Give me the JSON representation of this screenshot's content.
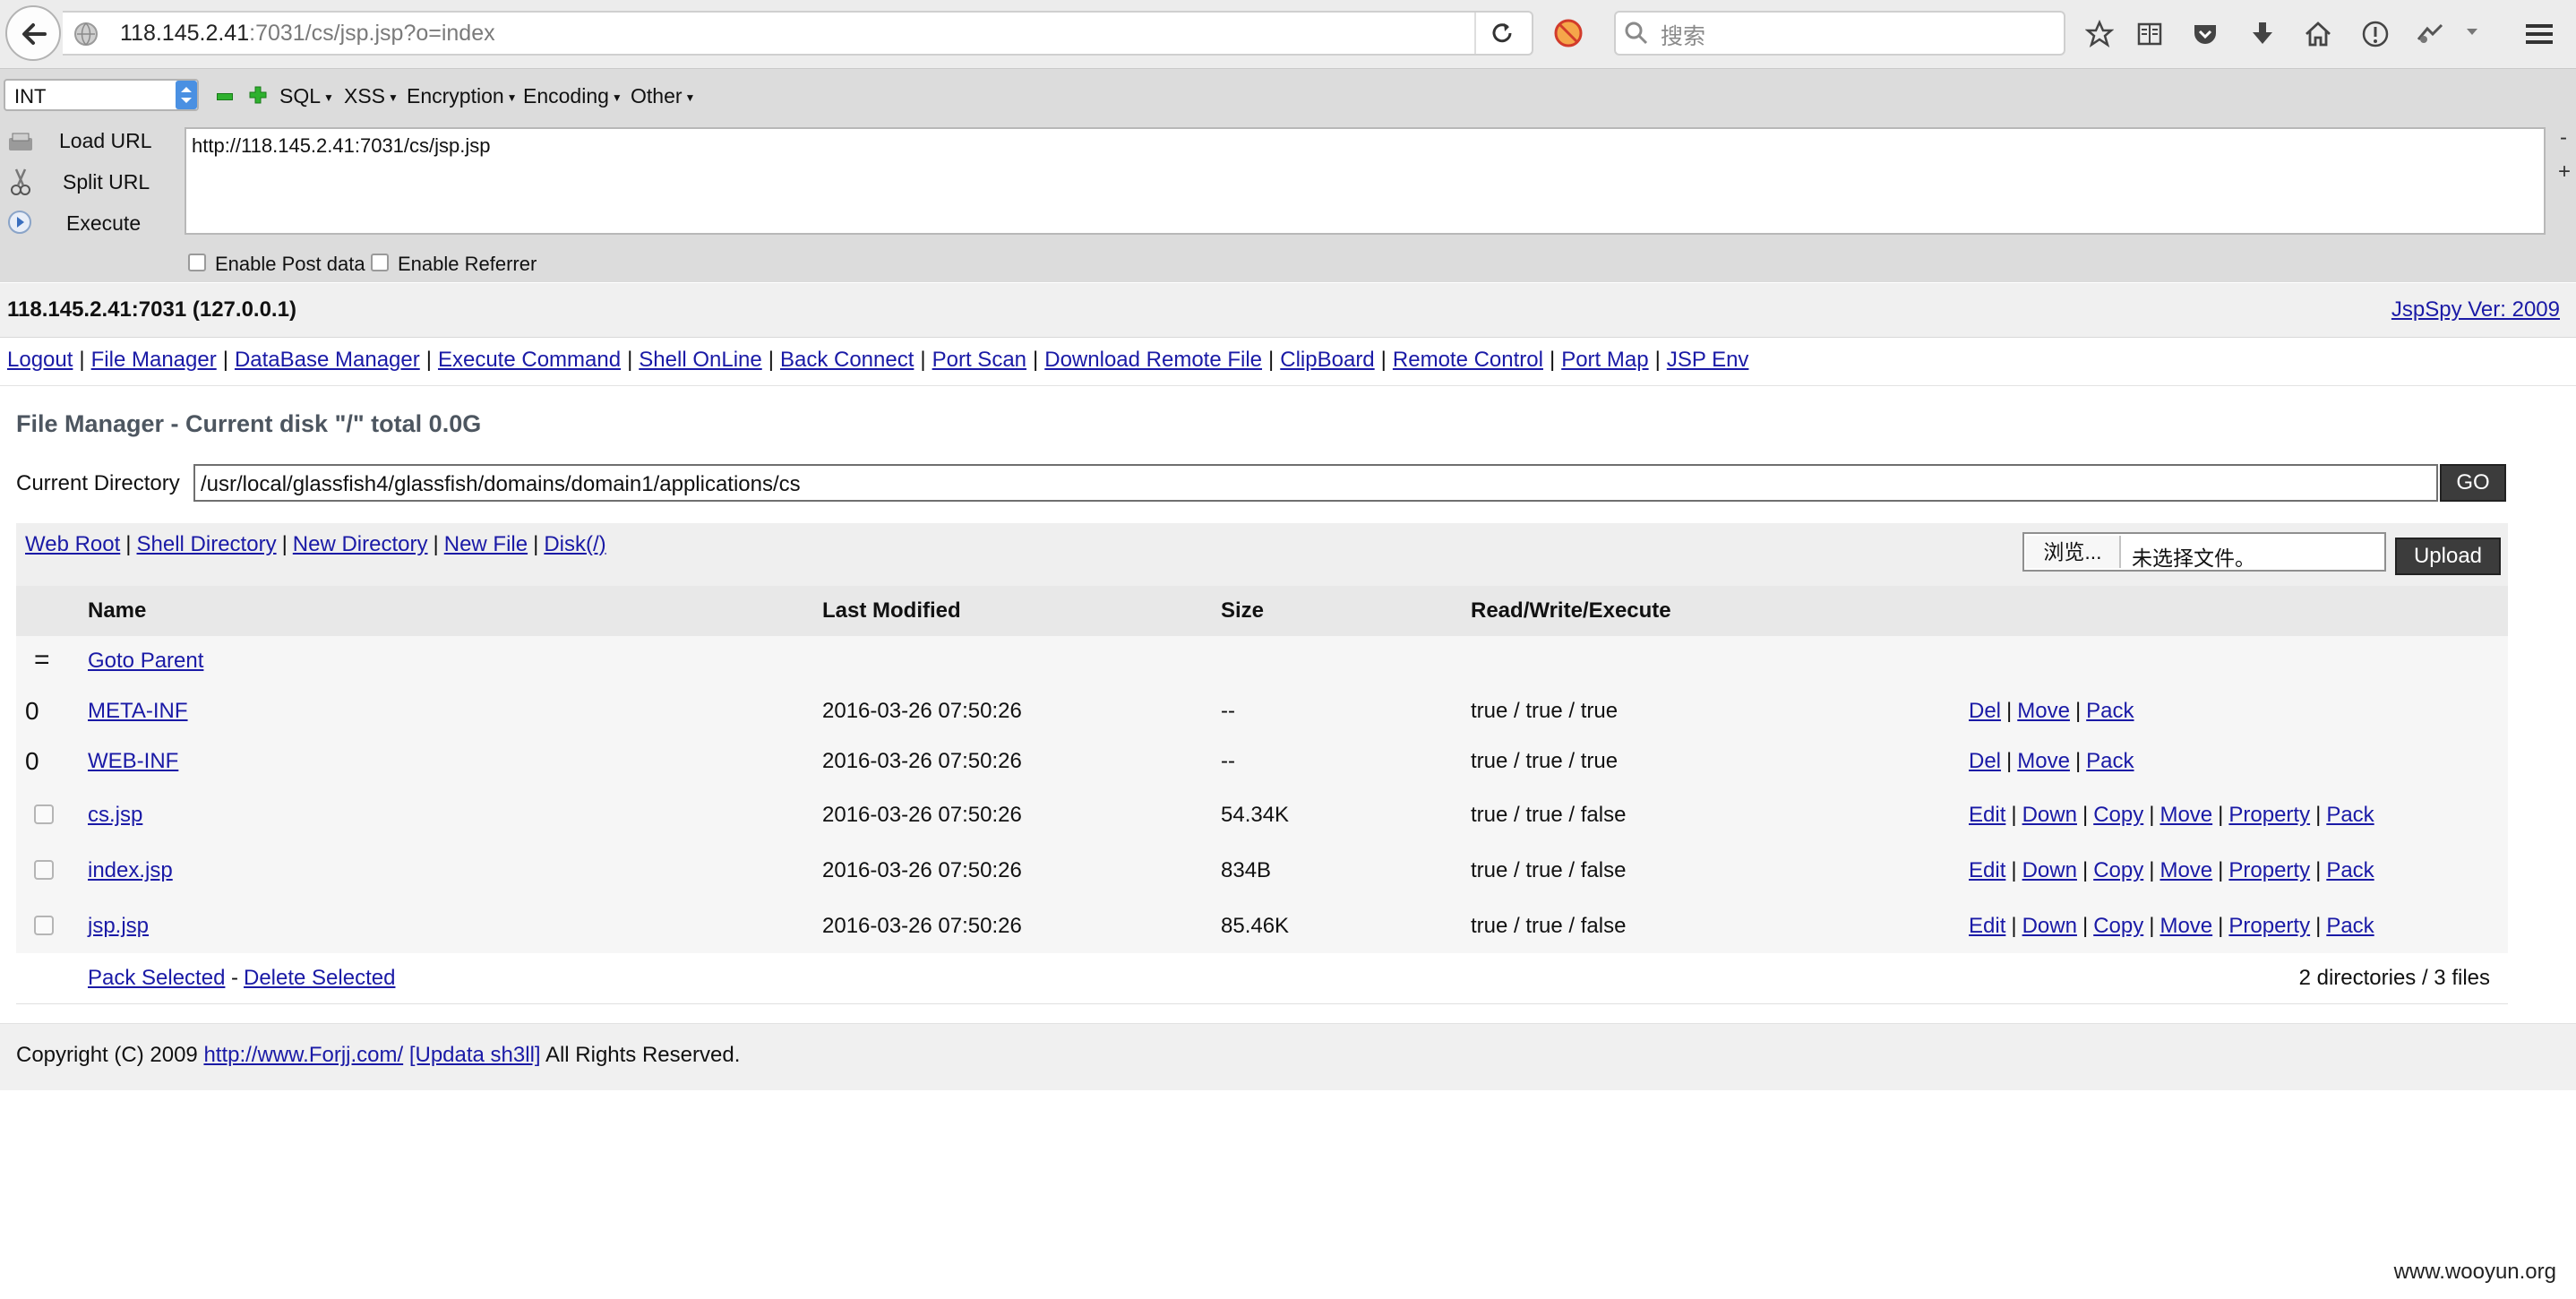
{
  "browser": {
    "url_host": "118.145.2.41",
    "url_rest": ":7031/cs/jsp.jsp?o=index",
    "search_placeholder": "搜索"
  },
  "hackbar": {
    "select_value": "INT",
    "menus": [
      "SQL",
      "XSS",
      "Encryption",
      "Encoding",
      "Other"
    ],
    "load_url": "Load URL",
    "split_url": "Split URL",
    "execute": "Execute",
    "url_value": "http://118.145.2.41:7031/cs/jsp.jsp",
    "enable_post": "Enable Post data",
    "enable_referrer": "Enable Referrer",
    "minus": "-",
    "plus": "+"
  },
  "page": {
    "host": "118.145.2.41:7031 (127.0.0.1)",
    "version_link": "JspSpy Ver: 2009",
    "nav": [
      "Logout",
      "File Manager",
      "DataBase Manager",
      "Execute Command",
      "Shell OnLine",
      "Back Connect",
      "Port Scan",
      "Download Remote File",
      "ClipBoard",
      "Remote Control",
      "Port Map",
      "JSP Env"
    ],
    "fm_title": "File Manager - Current disk \"/\" total 0.0G",
    "current_dir_label": "Current Directory",
    "current_dir": "/usr/local/glassfish4/glassfish/domains/domain1/applications/cs",
    "go": "GO",
    "tools": [
      "Web Root",
      "Shell Directory",
      "New Directory",
      "New File",
      "Disk(/)"
    ],
    "browse": "浏览...",
    "no_file": "未选择文件。",
    "upload": "Upload",
    "columns": [
      "Name",
      "Last Modified",
      "Size",
      "Read/Write/Execute"
    ],
    "parent_marker": "=",
    "goto_parent": "Goto Parent",
    "dirs": [
      {
        "marker": "0",
        "name": "META-INF",
        "modified": "2016-03-26 07:50:26",
        "size": "--",
        "perm": "true / true / true",
        "ops": [
          "Del",
          "Move",
          "Pack"
        ]
      },
      {
        "marker": "0",
        "name": "WEB-INF",
        "modified": "2016-03-26 07:50:26",
        "size": "--",
        "perm": "true / true / true",
        "ops": [
          "Del",
          "Move",
          "Pack"
        ]
      }
    ],
    "files": [
      {
        "name": "cs.jsp",
        "modified": "2016-03-26 07:50:26",
        "size": "54.34K",
        "perm": "true / true / false",
        "ops": [
          "Edit",
          "Down",
          "Copy",
          "Move",
          "Property",
          "Pack"
        ]
      },
      {
        "name": "index.jsp",
        "modified": "2016-03-26 07:50:26",
        "size": "834B",
        "perm": "true / true / false",
        "ops": [
          "Edit",
          "Down",
          "Copy",
          "Move",
          "Property",
          "Pack"
        ]
      },
      {
        "name": "jsp.jsp",
        "modified": "2016-03-26 07:50:26",
        "size": "85.46K",
        "perm": "true / true / false",
        "ops": [
          "Edit",
          "Down",
          "Copy",
          "Move",
          "Property",
          "Pack"
        ]
      }
    ],
    "pack_selected": "Pack Selected",
    "dash": "-",
    "delete_selected": "Delete Selected",
    "summary": "2 directories / 3 files",
    "footer_copyright": "Copyright (C) 2009",
    "footer_link": "http://www.Forjj.com/",
    "footer_updata": "[Updata sh3ll]",
    "footer_rights": "All Rights Reserved.",
    "watermark": "www.wooyun.org"
  }
}
